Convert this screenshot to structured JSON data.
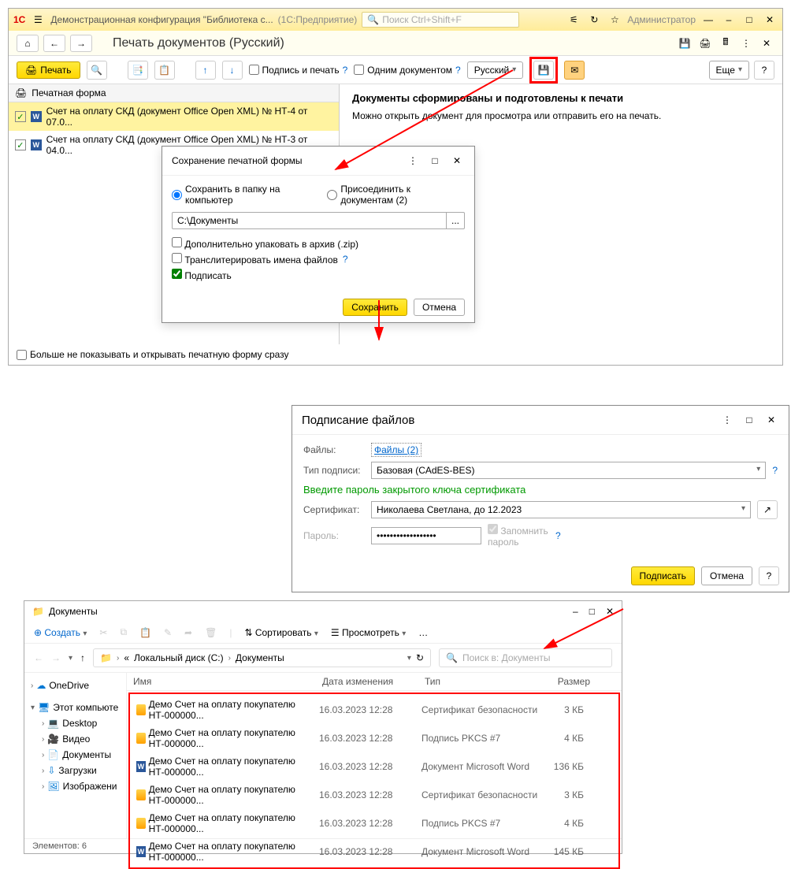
{
  "app": {
    "title": "Демонстрационная конфигурация \"Библиотека с...",
    "platform": "(1С:Предприятие)",
    "search_placeholder": "Поиск Ctrl+Shift+F",
    "user": "Администратор"
  },
  "page": {
    "title": "Печать документов (Русский)"
  },
  "tb": {
    "print": "Печать",
    "sign_print": "Подпись и печать",
    "one_doc": "Одним документом",
    "lang": "Русский",
    "more": "Еще"
  },
  "left": {
    "header": "Печатная форма",
    "rows": [
      "Счет на оплату СКД (документ Office Open XML) № НТ-4 от 07.0...",
      "Счет на оплату СКД (документ Office Open XML) № НТ-3 от 04.0..."
    ]
  },
  "right": {
    "heading": "Документы сформированы и подготовлены к печати",
    "text": "Можно открыть документ для просмотра или отправить его на печать."
  },
  "footer_check": "Больше не показывать и открывать печатную форму сразу",
  "save_dlg": {
    "title": "Сохранение печатной формы",
    "opt_folder": "Сохранить в папку на компьютер",
    "opt_attach": "Присоединить к документам (2)",
    "path": "C:\\Документы",
    "zip": "Дополнительно упаковать в архив (.zip)",
    "translit": "Транслитерировать имена файлов",
    "sign": "Подписать",
    "save": "Сохранить",
    "cancel": "Отмена"
  },
  "sign_dlg": {
    "title": "Подписание файлов",
    "files_label": "Файлы:",
    "files_link": "Файлы (2)",
    "type_label": "Тип подписи:",
    "type_value": "Базовая (CAdES-BES)",
    "prompt": "Введите пароль закрытого ключа сертификата",
    "cert_label": "Сертификат:",
    "cert_value": "Николаева Светлана, до 12.2023",
    "pwd_label": "Пароль:",
    "remember": "Запомнить пароль",
    "sign_btn": "Подписать",
    "cancel": "Отмена"
  },
  "explorer": {
    "title": "Документы",
    "create": "Создать",
    "sort": "Сортировать",
    "view": "Просмотреть",
    "breadcrumb1": "Локальный диск (C:)",
    "breadcrumb2": "Документы",
    "search_ph": "Поиск в: Документы",
    "cols": {
      "name": "Имя",
      "date": "Дата изменения",
      "type": "Тип",
      "size": "Размер"
    },
    "tree": {
      "onedrive": "OneDrive",
      "thispc": "Этот компьюте",
      "desktop": "Desktop",
      "video": "Видео",
      "docs": "Документы",
      "downloads": "Загрузки",
      "images": "Изображени"
    },
    "files": [
      {
        "name": "Демо  Счет на оплату покупателю НТ-000000...",
        "date": "16.03.2023 12:28",
        "type": "Сертификат безопасности",
        "size": "3 КБ",
        "icon": "cert"
      },
      {
        "name": "Демо  Счет на оплату покупателю НТ-000000...",
        "date": "16.03.2023 12:28",
        "type": "Подпись PKCS #7",
        "size": "4 КБ",
        "icon": "cert"
      },
      {
        "name": "Демо  Счет на оплату покупателю НТ-000000...",
        "date": "16.03.2023 12:28",
        "type": "Документ Microsoft Word",
        "size": "136 КБ",
        "icon": "word"
      },
      {
        "name": "Демо  Счет на оплату покупателю НТ-000000...",
        "date": "16.03.2023 12:28",
        "type": "Сертификат безопасности",
        "size": "3 КБ",
        "icon": "cert"
      },
      {
        "name": "Демо  Счет на оплату покупателю НТ-000000...",
        "date": "16.03.2023 12:28",
        "type": "Подпись PKCS #7",
        "size": "4 КБ",
        "icon": "cert"
      },
      {
        "name": "Демо  Счет на оплату покупателю НТ-000000...",
        "date": "16.03.2023 12:28",
        "type": "Документ Microsoft Word",
        "size": "145 КБ",
        "icon": "word"
      }
    ],
    "status": "Элементов: 6"
  }
}
